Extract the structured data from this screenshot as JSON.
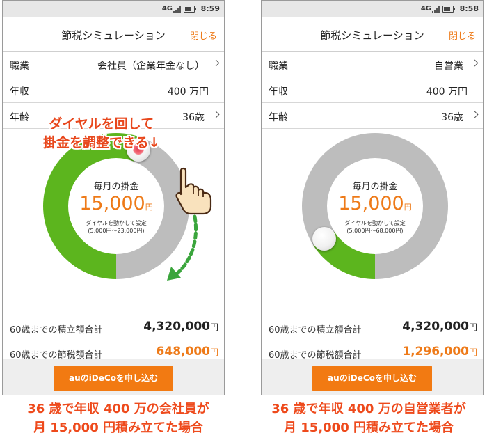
{
  "screens": [
    {
      "status": {
        "network": "4G",
        "time": "8:59"
      },
      "title": "節税シミュレーション",
      "close_label": "閉じる",
      "rows": [
        {
          "label": "職業",
          "value": "会社員（企業年金なし）"
        },
        {
          "label": "年収",
          "value": "400 万円"
        },
        {
          "label": "年齢",
          "value": "36歳"
        }
      ],
      "dial": {
        "caption": "毎月の掛金",
        "amount": "15,000",
        "unit": "円",
        "hint_line1": "ダイヤルを動かして設定",
        "hint_line2": "(5,000円〜23,000円)",
        "fill_fraction": 0.56
      },
      "totals": [
        {
          "label": "60歳までの積立額合計",
          "value": "4,320,000",
          "unit": "円",
          "accent": false
        },
        {
          "label": "60歳までの節税額合計",
          "value": "648,000",
          "unit": "円",
          "accent": true
        }
      ],
      "apply_label": "auのiDeCoを申し込む",
      "annotation_line1": "ダイヤルを回して",
      "annotation_line2": "掛金を調整できる↓"
    },
    {
      "status": {
        "network": "4G",
        "time": "8:58"
      },
      "title": "節税シミュレーション",
      "close_label": "閉じる",
      "rows": [
        {
          "label": "職業",
          "value": "自営業"
        },
        {
          "label": "年収",
          "value": "400 万円"
        },
        {
          "label": "年齢",
          "value": "36歳"
        }
      ],
      "dial": {
        "caption": "毎月の掛金",
        "amount": "15,000",
        "unit": "円",
        "hint_line1": "ダイヤルを動かして設定",
        "hint_line2": "(5,000円〜68,000円)",
        "fill_fraction": 0.16
      },
      "totals": [
        {
          "label": "60歳までの積立額合計",
          "value": "4,320,000",
          "unit": "円",
          "accent": false
        },
        {
          "label": "60歳までの節税額合計",
          "value": "1,296,000",
          "unit": "円",
          "accent": true
        }
      ],
      "apply_label": "auのiDeCoを申し込む"
    }
  ],
  "captions": [
    {
      "line1": "36 歳で年収 400 万の会社員が",
      "line2": "月 15,000 円積み立てた場合"
    },
    {
      "line1": "36 歳で年収 400 万の自営業者が",
      "line2": "月 15,000 円積み立てた場合"
    }
  ],
  "colors": {
    "accent_orange": "#f27a12",
    "dial_green": "#5cb51e",
    "dial_gray": "#bdbdbd",
    "annotation_red": "#e8471c",
    "arrow_green": "#3aa53c"
  }
}
